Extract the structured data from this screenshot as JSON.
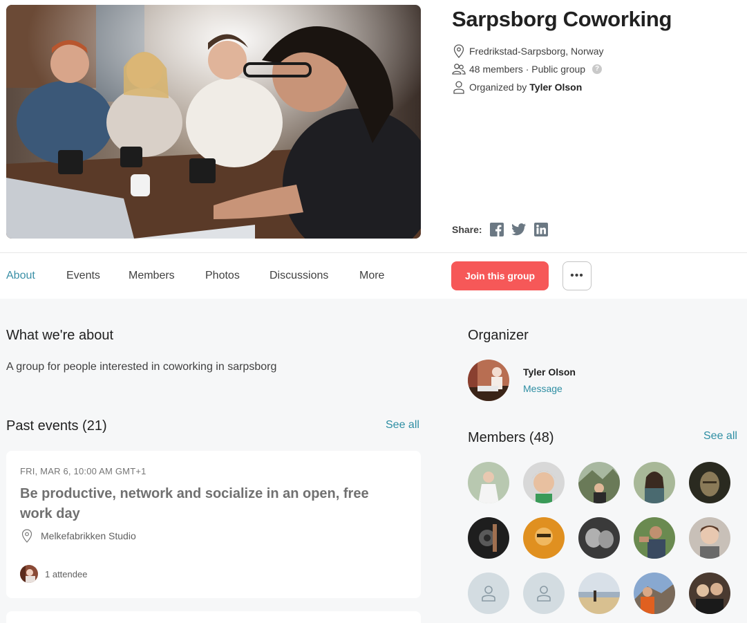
{
  "group": {
    "title": "Sarpsborg Coworking",
    "location": "Fredrikstad-Sarpsborg, Norway",
    "members_info": "48 members · Public group",
    "organized_by_prefix": "Organized by",
    "organizer_name": "Tyler Olson",
    "help_badge": "?"
  },
  "share": {
    "label": "Share:",
    "icons": [
      "facebook-icon",
      "twitter-icon",
      "linkedin-icon"
    ]
  },
  "nav": {
    "tabs": [
      {
        "label": "About",
        "active": true
      },
      {
        "label": "Events",
        "active": false
      },
      {
        "label": "Members",
        "active": false
      },
      {
        "label": "Photos",
        "active": false
      },
      {
        "label": "Discussions",
        "active": false
      },
      {
        "label": "More",
        "active": false
      }
    ],
    "join_label": "Join this group",
    "more_label": "•••"
  },
  "about": {
    "title": "What we're about",
    "text": "A group for people interested in coworking in sarpsborg"
  },
  "past_events": {
    "title": "Past events (21)",
    "see_all": "See all",
    "event": {
      "date": "FRI, MAR 6, 10:00 AM GMT+1",
      "title": "Be productive, network and socialize in an open, free work day",
      "venue": "Melkefabrikken Studio",
      "attendees": "1 attendee"
    }
  },
  "organizer": {
    "title": "Organizer",
    "name": "Tyler Olson",
    "message": "Message"
  },
  "members": {
    "title": "Members (48)",
    "see_all": "See all"
  },
  "colors": {
    "accent": "#2e8ea3",
    "join_button": "#f65858",
    "background": "#f6f7f8"
  }
}
